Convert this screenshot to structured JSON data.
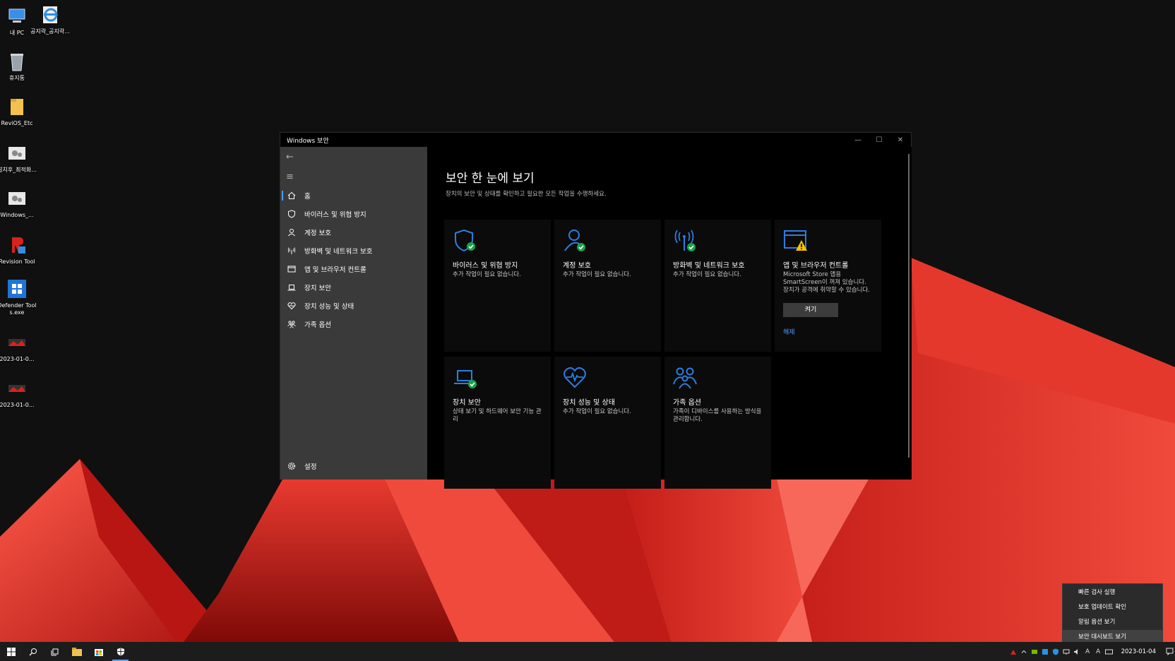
{
  "desktop": {
    "icons": [
      {
        "label": "내 PC"
      },
      {
        "label": "공지락_공지락..."
      },
      {
        "label": "휴지통"
      },
      {
        "label": "ReviOS_Etc"
      },
      {
        "label": "설치후_최적화..."
      },
      {
        "label": "Windows_..."
      },
      {
        "label": "Revision Tool"
      },
      {
        "label": "Defender Tools.exe"
      },
      {
        "label": "2023-01-0..."
      },
      {
        "label": "2023-01-0..."
      }
    ]
  },
  "window": {
    "title": "Windows 보안",
    "controls": {
      "minimize": "—",
      "maximize": "☐",
      "close": "✕"
    },
    "sidebar": {
      "back": "←",
      "menu": "≡",
      "items": [
        {
          "label": "홈",
          "icon": "home-icon"
        },
        {
          "label": "바이러스 및 위협 방지",
          "icon": "shield-icon"
        },
        {
          "label": "계정 보호",
          "icon": "person-icon"
        },
        {
          "label": "방화벽 및 네트워크 보호",
          "icon": "antenna-icon"
        },
        {
          "label": "앱 및 브라우저 컨트롤",
          "icon": "browser-icon"
        },
        {
          "label": "장치 보안",
          "icon": "laptop-icon"
        },
        {
          "label": "장치 성능 및 상태",
          "icon": "heart-icon"
        },
        {
          "label": "가족 옵션",
          "icon": "family-icon"
        }
      ],
      "settings": "설정"
    },
    "main": {
      "title": "보안 한 눈에 보기",
      "subtitle": "장치의 보안 및 상태를 확인하고 필요한 모든 작업을 수행하세요.",
      "tiles": [
        {
          "name": "바이러스 및 위협 방지",
          "desc": "추가 작업이 필요 없습니다.",
          "icon": "shield-check-icon"
        },
        {
          "name": "계정 보호",
          "desc": "추가 작업이 필요 없습니다.",
          "icon": "person-check-icon"
        },
        {
          "name": "방화벽 및 네트워크 보호",
          "desc": "추가 작업이 필요 없습니다.",
          "icon": "antenna-check-icon"
        },
        {
          "name": "앱 및 브라우저 컨트롤",
          "desc": "Microsoft Store 앱용 SmartScreen이 꺼져 있습니다. 장치가 공격에 취약할 수 있습니다.",
          "icon": "browser-warning-icon",
          "button": "켜기",
          "link": "해제"
        },
        {
          "name": "장치 보안",
          "desc": "상태 보기 및 하드웨어 보안 기능 관리",
          "icon": "laptop-check-icon"
        },
        {
          "name": "장치 성능 및 상태",
          "desc": "추가 작업이 필요 없습니다.",
          "icon": "heart-pulse-icon"
        },
        {
          "name": "가족 옵션",
          "desc": "가족이 디바이스를 사용하는 방식을 관리합니다.",
          "icon": "family-icon"
        }
      ]
    }
  },
  "context_menu": {
    "items": [
      "빠른 검사 실행",
      "보호 업데이트 확인",
      "알림 옵션 보기",
      "보안 대시보드 보기"
    ]
  },
  "taskbar": {
    "clock": "2023-01-04",
    "tray_text": [
      "A",
      "A"
    ]
  },
  "colors": {
    "accent": "#4a9cff",
    "icon_blue": "#2d7de0",
    "check_green": "#16a34a",
    "warning_yellow": "#f5c400",
    "sidebar_bg": "#3a3a3a",
    "wallpaper_red": "#d8302a"
  }
}
